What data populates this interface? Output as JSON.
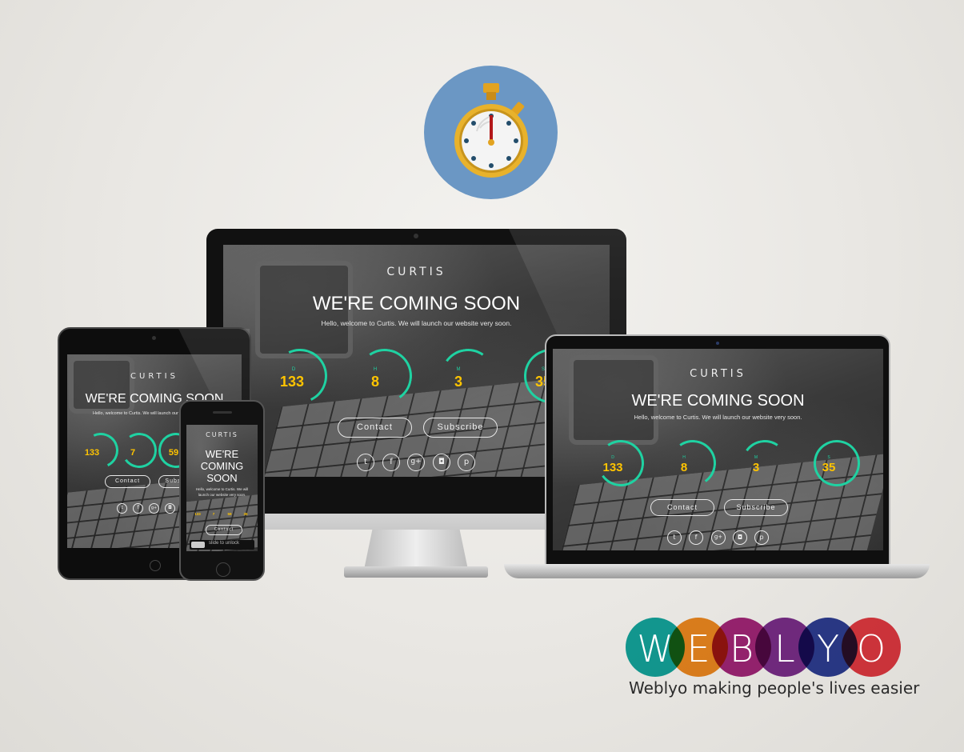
{
  "brand": "CURTIS",
  "headline": "WE'RE COMING SOON",
  "headline_phone": [
    "WE'RE",
    "COMING",
    "SOON"
  ],
  "welcome": "Hello, welcome to Curtis. We will launch our website very soon.",
  "phone_welcome": [
    "Hello, welcome to Curtis. We will",
    "launch our website very soon."
  ],
  "countdown": {
    "days": "133",
    "hours": "8",
    "minutes": "3",
    "seconds": "35",
    "days_label": "D",
    "hours_label": "H",
    "minutes_label": "M",
    "seconds_label": "S",
    "tablet_hours": "7",
    "tablet_minutes": "59"
  },
  "buttons": {
    "contact": "Contact",
    "subscribe": "Subscribe"
  },
  "phone_lock": {
    "slider": "slide to unlock"
  },
  "social_icons": [
    "twitter-icon",
    "facebook-icon",
    "google-plus-icon",
    "instagram-icon",
    "pinterest-icon"
  ],
  "weblyo": {
    "letters": [
      "W",
      "E",
      "B",
      "L",
      "Y",
      "O"
    ],
    "colors": [
      "#13a6a0",
      "#ef8a1f",
      "#a3267b",
      "#7b2e8e",
      "#2d3e97",
      "#e43a43"
    ],
    "tagline": "Weblyo making people's lives easier"
  },
  "colors": {
    "accent_teal": "#1fd2a2",
    "counter_yellow": "#ffc400",
    "stopwatch_bg": "#6b97c4"
  }
}
